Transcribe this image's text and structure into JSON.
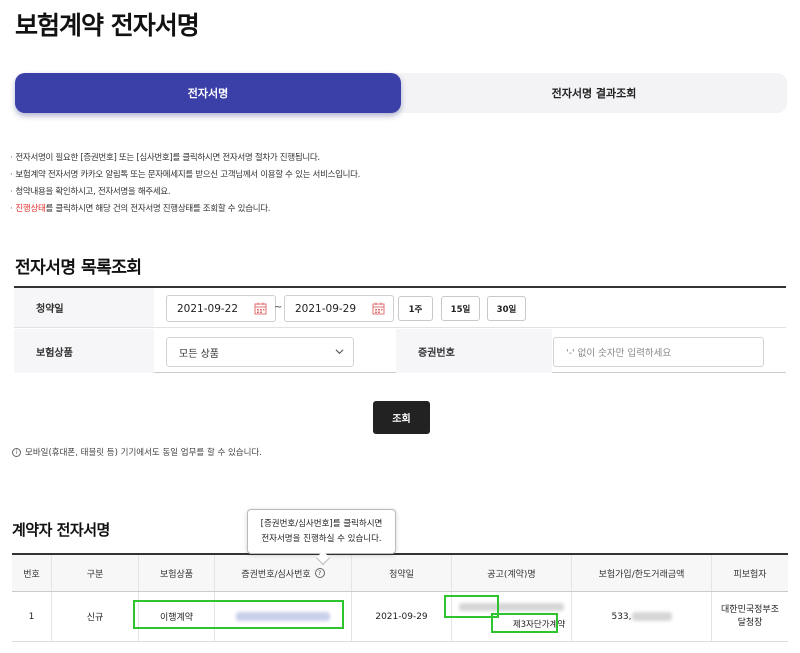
{
  "page": {
    "title": "보험계약 전자서명"
  },
  "tabs": [
    {
      "label": "전자서명",
      "active": true
    },
    {
      "label": "전자서명 결과조회",
      "active": false
    }
  ],
  "notes": [
    "전자서명이 필요한 [증권번호] 또는 [심사번호]를 클릭하시면 전자서명 절차가 진행됩니다.",
    "보험계약 전자서명 카카오 알림톡 또는 문자메세지를 받으신 고객님께서 이용할 수 있는 서비스입니다.",
    "청약내용을 확인하시고, 전자서명을 해주세요."
  ],
  "note_status": {
    "highlight": "진행상태",
    "rest": "를 클릭하시면 해당 건의 전자서명 진행상태를 조회할 수 있습니다."
  },
  "colors": {
    "brand": "#3b3fa8",
    "highlight_red": "#e0302a",
    "annotation_green": "#2ec42e"
  },
  "search": {
    "section_title": "전자서명 목록조회",
    "date_label": "청약일",
    "date_from": "2021-09-22",
    "date_sep": "~",
    "date_to": "2021-09-29",
    "periods": [
      "1주",
      "15일",
      "30일"
    ],
    "product_label": "보험상품",
    "product_selected": "모든 상품",
    "policy_label": "증권번호",
    "policy_placeholder": "'-' 없이 숫자만 입력하세요",
    "search_button": "조회"
  },
  "mobile_note": "모바일(휴대폰, 태블릿 등) 기기에서도 동일 업무를 할 수 있습니다.",
  "results": {
    "section_title": "계약자 전자서명",
    "tooltip_lines": [
      "[증권번호/심사번호]를 클릭하시면",
      "전자서명을 진행하실 수 있습니다."
    ],
    "columns": [
      "번호",
      "구분",
      "보험상품",
      "증권번호/심사번호",
      "청약일",
      "공고(계약)명",
      "보험가입/한도거래금액",
      "피보험자"
    ],
    "rows": [
      {
        "no": "1",
        "type": "신규",
        "product": "이행계약",
        "policy_no": "",
        "date": "2021-09-29",
        "contract_name": "제3자단가계약",
        "amount_prefix": "533,",
        "insured": "대한민국정부조달청장"
      }
    ]
  }
}
